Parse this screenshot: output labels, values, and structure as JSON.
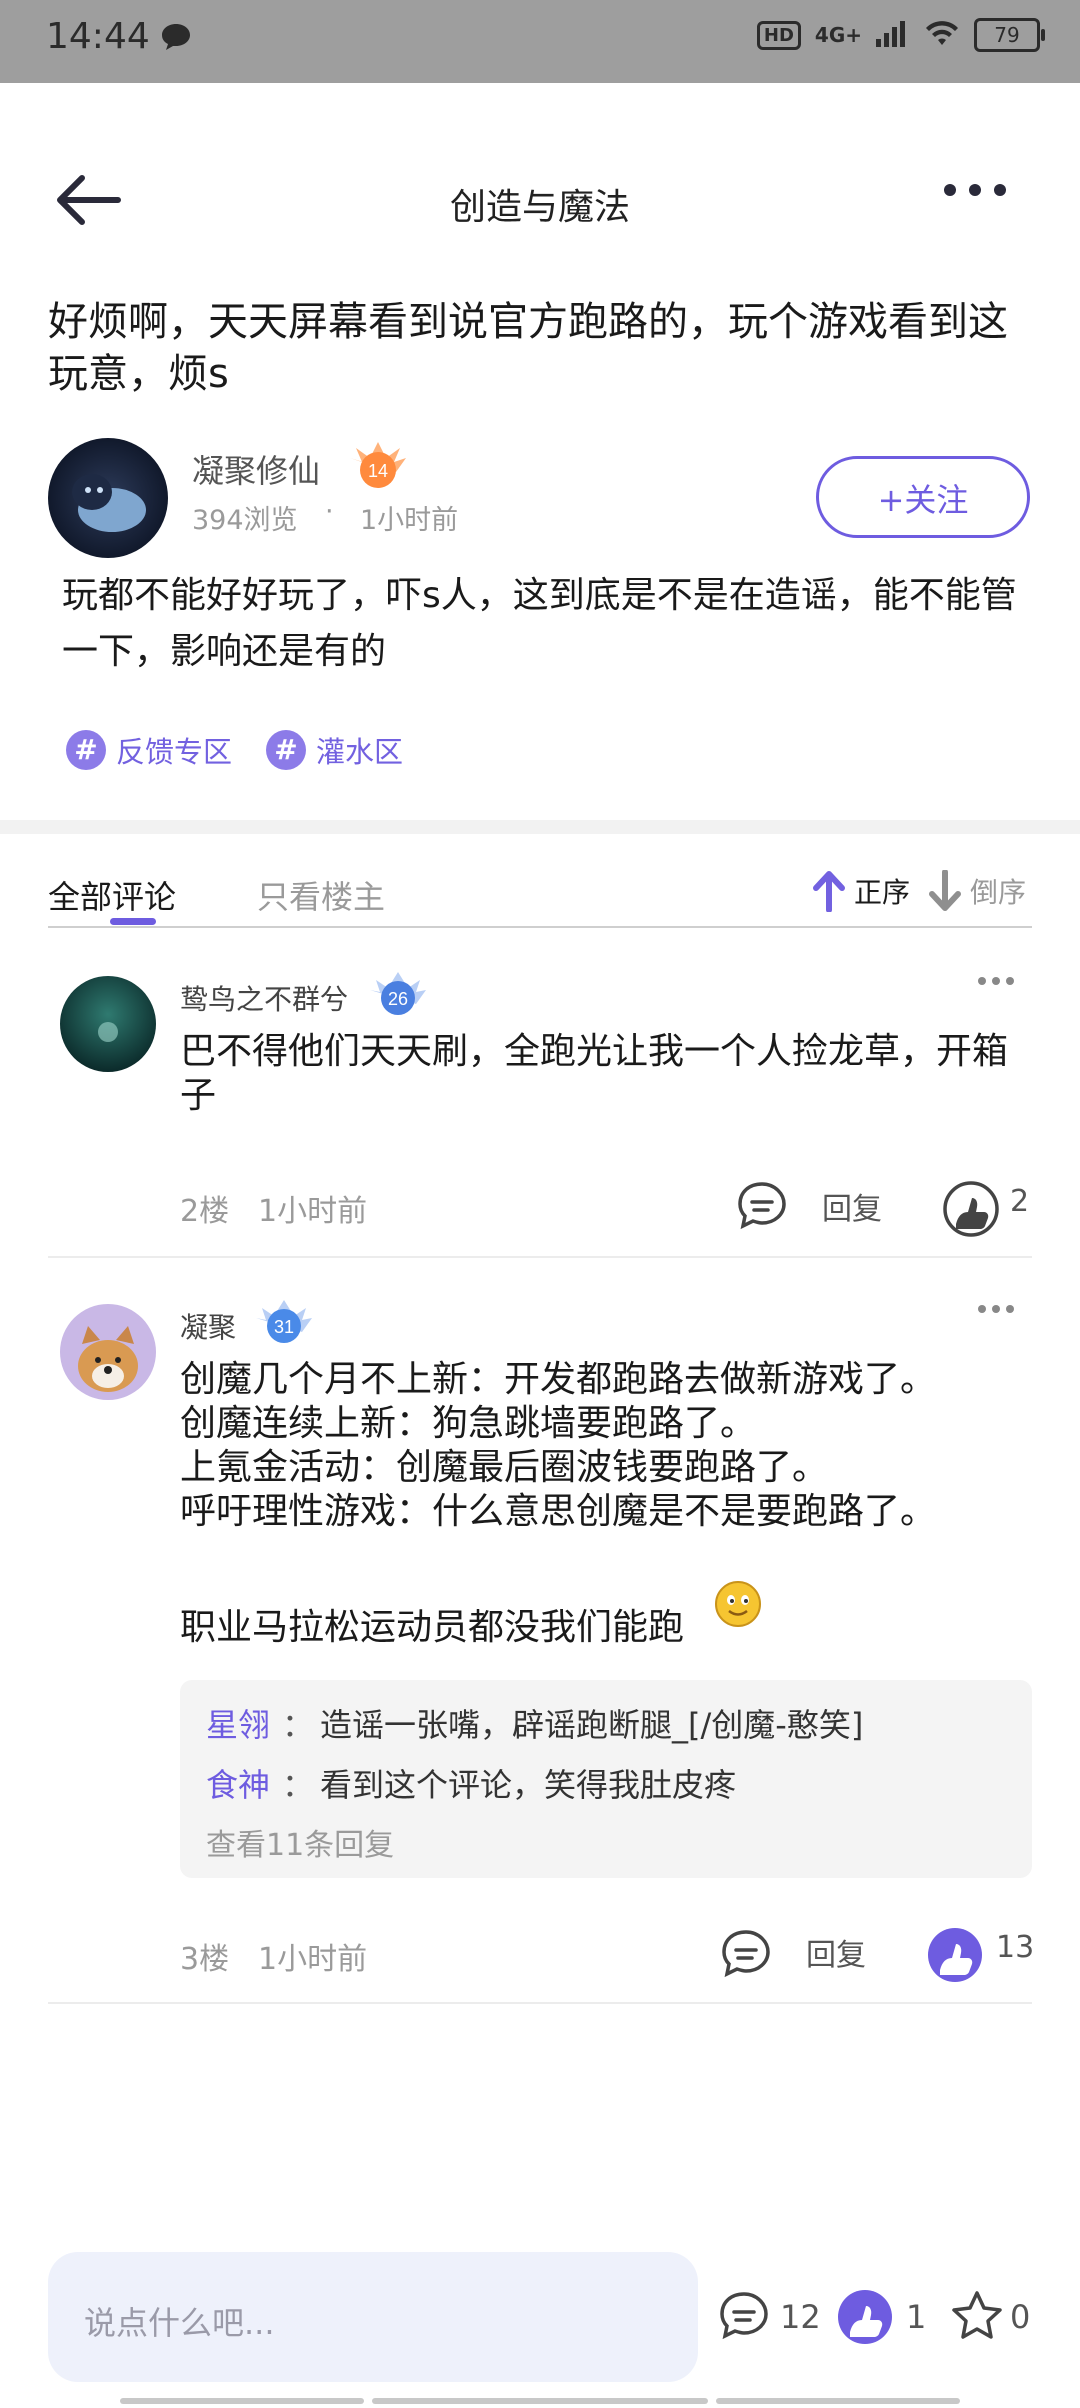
{
  "status_bar": {
    "time": "14:44",
    "network": "4G+",
    "hd": "HD",
    "battery": "79"
  },
  "header": {
    "title": "创造与魔法"
  },
  "post": {
    "title": "好烦啊，天天屏幕看到说官方跑路的，玩个游戏看到这玩意，烦s",
    "author": "凝聚修仙",
    "level": "14",
    "views": "394浏览",
    "separator": "·",
    "time": "1小时前",
    "follow_label": "+关注",
    "body": "玩都不能好好玩了，吓s人，这到底是不是在造谣，能不能管一下，影响还是有的",
    "topics": [
      {
        "label": "反馈专区"
      },
      {
        "label": "灌水区"
      }
    ]
  },
  "tabs": {
    "all": "全部评论",
    "owner_only": "只看楼主",
    "sort_asc": "正序",
    "sort_desc": "倒序"
  },
  "comments": [
    {
      "name": "鸷鸟之不群兮",
      "level": "26",
      "text": "巴不得他们天天刷，全跑光让我一个人捡龙草，开箱子",
      "floor": "2楼",
      "time": "1小时前",
      "reply_label": "回复",
      "likes": "2"
    },
    {
      "name": "凝聚",
      "level": "31",
      "lines": [
        "创魔几个月不上新：开发都跑路去做新游戏了。",
        "创魔连续上新：狗急跳墙要跑路了。",
        "上氪金活动：创魔最后圈波钱要跑路了。",
        "呼吁理性游戏：什么意思创魔是不是要跑路了。",
        "",
        "职业马拉松运动员都没我们能跑"
      ],
      "replies": [
        {
          "user": "星翎",
          "colon": "：",
          "text": "造谣一张嘴，辟谣跑断腿_[/创魔-憨笑]"
        },
        {
          "user": "食神",
          "colon": "：",
          "text": "看到这个评论，笑得我肚皮疼"
        }
      ],
      "more_replies": "查看11条回复",
      "floor": "3楼",
      "time": "1小时前",
      "reply_label": "回复",
      "likes": "13"
    }
  ],
  "bottom_bar": {
    "placeholder": "说点什么吧...",
    "comments": "12",
    "likes": "1",
    "stars": "0"
  },
  "colors": {
    "accent": "#6e5ce0",
    "status_bar": "#9e9e9e"
  }
}
